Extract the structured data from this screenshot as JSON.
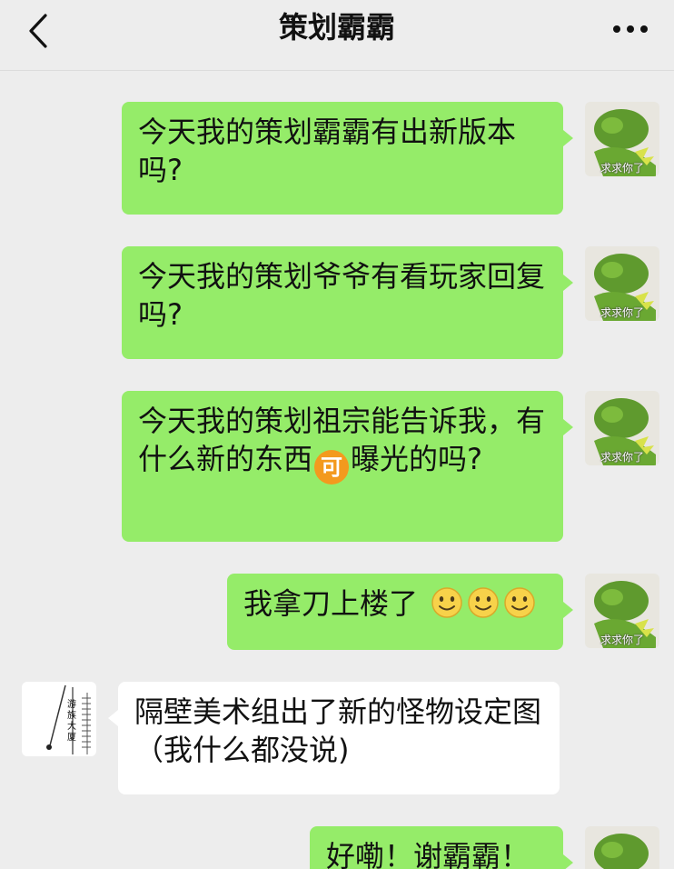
{
  "header": {
    "title": "策划霸霸",
    "back_icon": "chevron-left-icon",
    "more_icon": "more-dots-icon"
  },
  "avatar_caption": "求求你了",
  "messages": [
    {
      "sender": "me",
      "text": "今天我的策划霸霸有出新版本吗?"
    },
    {
      "sender": "me",
      "text": "今天我的策划爷爷有看玩家回复吗?"
    },
    {
      "sender": "me",
      "text_before": "今天我的策划祖宗能告诉我，有什么新的东西",
      "emoji": "可",
      "text_after": "曝光的吗?"
    },
    {
      "sender": "me",
      "text": "我拿刀上楼了",
      "emojis": [
        "smile-emoji",
        "smile-emoji",
        "smile-emoji"
      ]
    },
    {
      "sender": "other",
      "text": "隔壁美术组出了新的怪物设定图（我什么都没说)",
      "avatar_text": "游族大厦"
    },
    {
      "sender": "me",
      "text": "好嘞！谢霸霸！"
    }
  ],
  "colors": {
    "bubble_me": "#95ec69",
    "bubble_other": "#ffffff",
    "background": "#ededed"
  }
}
